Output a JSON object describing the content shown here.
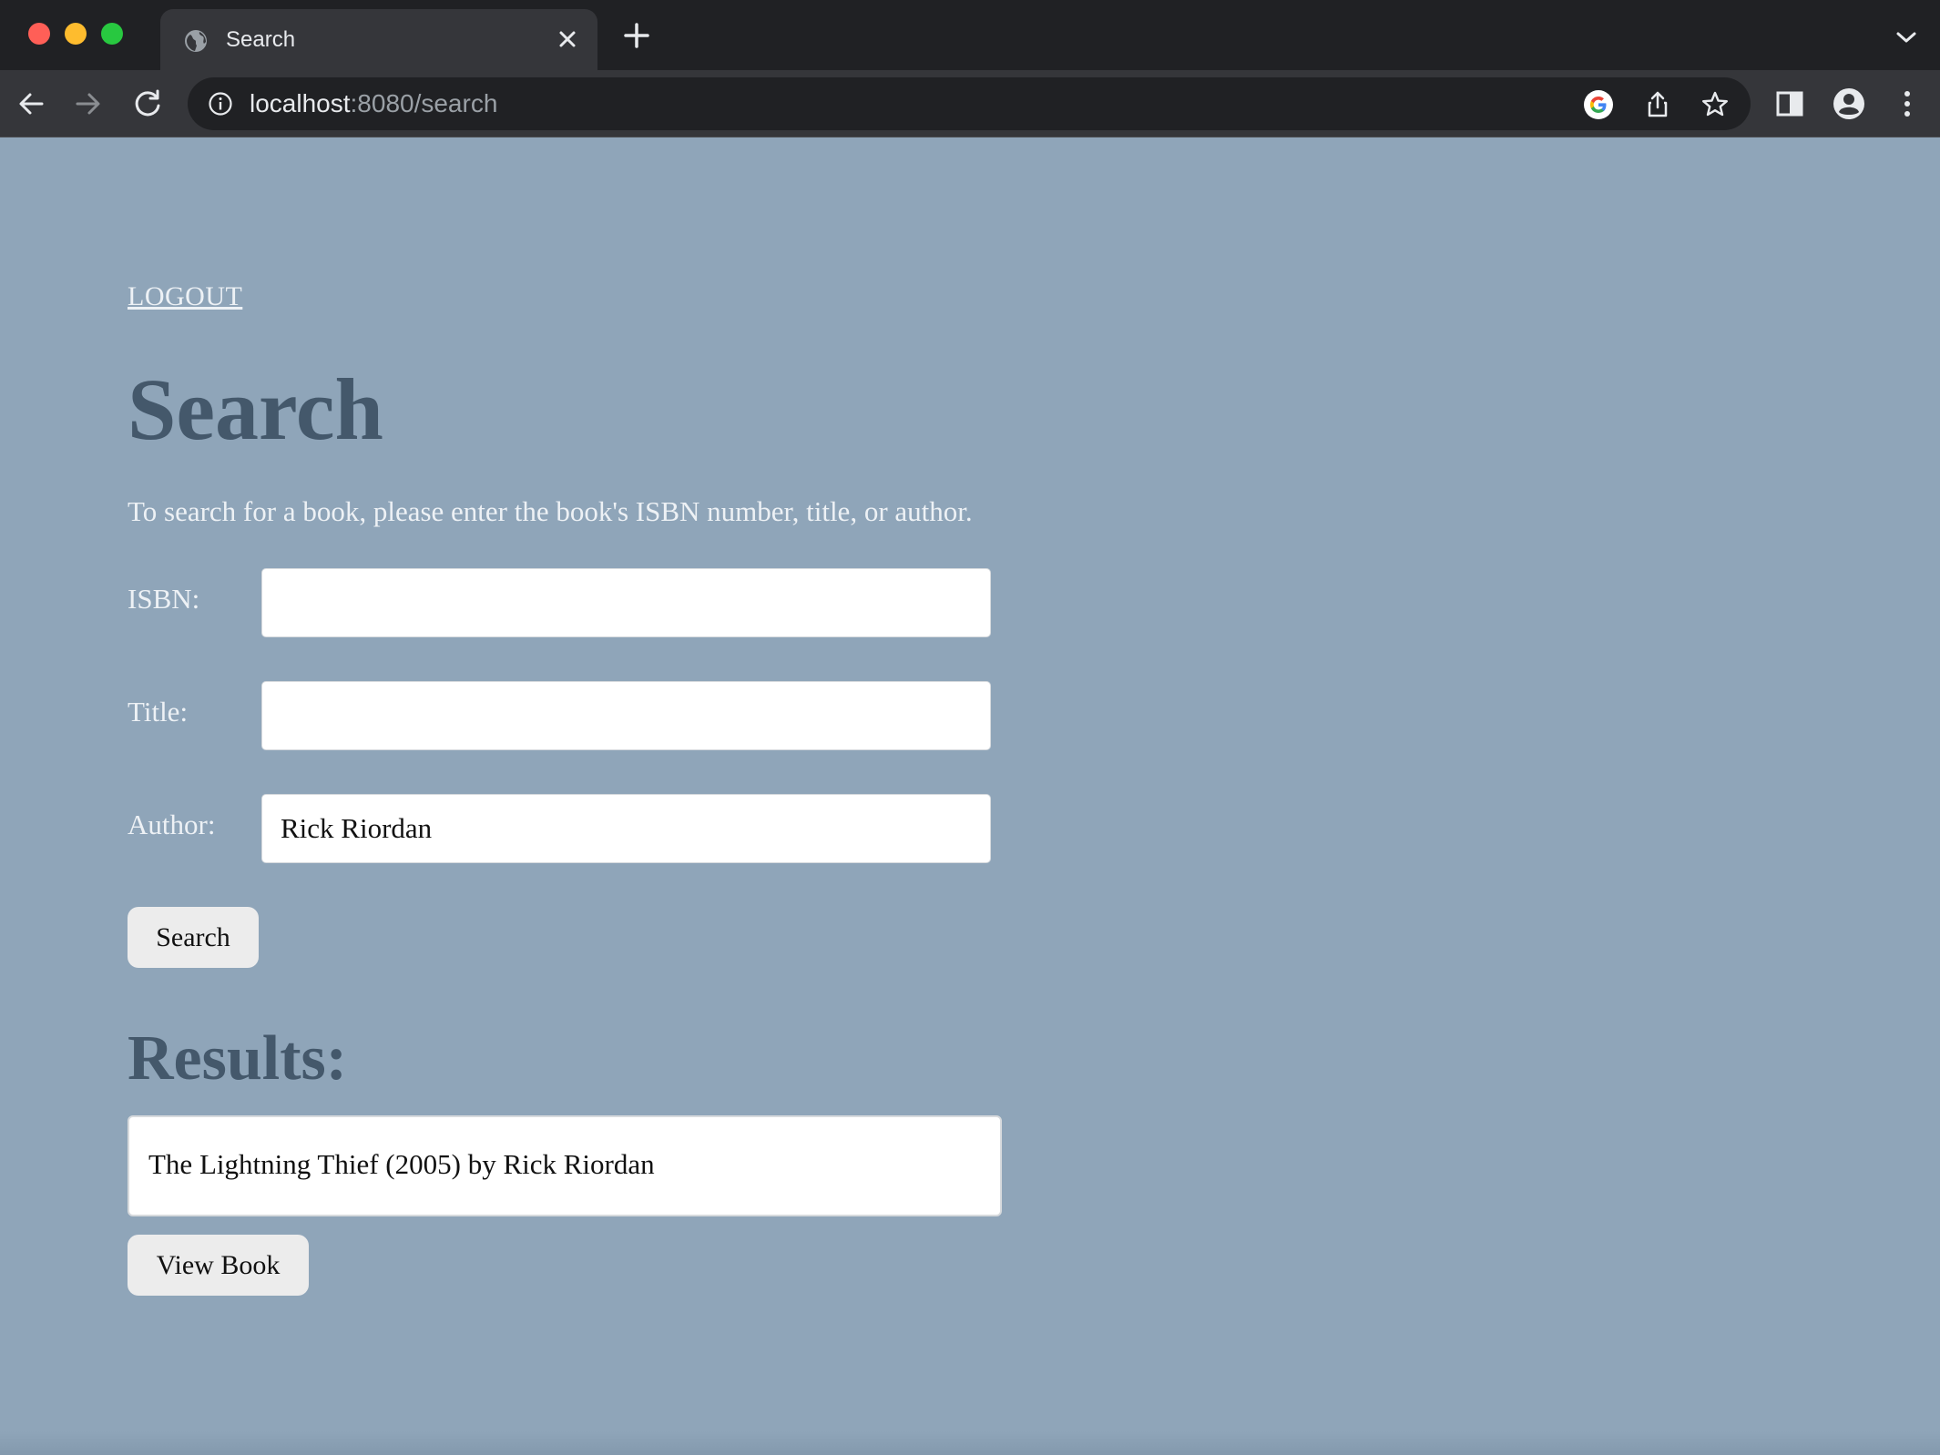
{
  "browser": {
    "tab": {
      "title": "Search"
    },
    "address_bar": {
      "host": "localhost",
      "rest": ":8080/search"
    }
  },
  "page": {
    "logout_label": "LOGOUT",
    "title": "Search",
    "instructions": "To search for a book, please enter the book's ISBN number, title, or author.",
    "form": {
      "isbn_label": "ISBN:",
      "isbn_value": "",
      "title_label": "Title:",
      "title_value": "",
      "author_label": "Author:",
      "author_value": "Rick Riordan",
      "search_button": "Search"
    },
    "results_heading": "Results:",
    "results": [
      {
        "text": "The Lightning Thief (2005) by Rick Riordan"
      }
    ],
    "view_button": "View Book"
  },
  "colors": {
    "page_background": "#8fa5b9",
    "heading": "#44586b",
    "light_text": "#edf1f5",
    "chrome_dark": "#202124",
    "chrome_toolbar": "#35363a"
  },
  "icons": [
    "globe-icon",
    "close-icon",
    "plus-icon",
    "chevron-down-icon",
    "back-arrow-icon",
    "forward-arrow-icon",
    "reload-icon",
    "info-icon",
    "google-icon",
    "share-icon",
    "star-icon",
    "side-panel-icon",
    "profile-icon",
    "kebab-menu-icon"
  ]
}
